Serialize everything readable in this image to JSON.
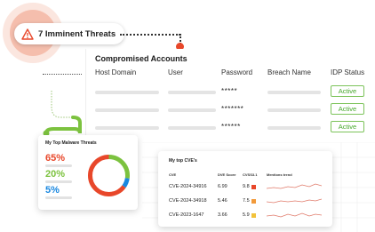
{
  "colors": {
    "accent": "#e8472a",
    "status_active": "#48a82c",
    "malware_pct_1": "#e8472a",
    "malware_pct_2": "#7cc23f",
    "malware_pct_3": "#1a88e0",
    "cvss_high": "#e8472a",
    "cvss_medium": "#f29a3a",
    "cvss_low": "#f2c23a"
  },
  "threat_badge": {
    "icon": "warning-triangle-icon",
    "label": "7 Imminent Threats"
  },
  "compromised_accounts": {
    "title": "Compromised Accounts",
    "columns": [
      "Host Domain",
      "User",
      "Password",
      "Breach Name",
      "IDP Status"
    ],
    "rows": [
      {
        "password": "*****",
        "status": "Active"
      },
      {
        "password": "*******",
        "status": "Active"
      },
      {
        "password": "******",
        "status": "Active"
      }
    ]
  },
  "malware": {
    "title": "My Top Malware Threats",
    "items": [
      {
        "value": "65%"
      },
      {
        "value": "20%"
      },
      {
        "value": "5%"
      }
    ]
  },
  "cve": {
    "title": "My top CVE's",
    "columns": [
      "CVE",
      "DVE Score",
      "CVSS3.1",
      "Mentions trend"
    ],
    "rows": [
      {
        "id": "CVE-2024-34916",
        "score": "6.99",
        "cvss": "9.8",
        "severity": "high"
      },
      {
        "id": "CVE-2024-34918",
        "score": "5.46",
        "cvss": "7.5",
        "severity": "medium"
      },
      {
        "id": "CVE-2023-1647",
        "score": "3.66",
        "cvss": "5.9",
        "severity": "low"
      }
    ]
  }
}
